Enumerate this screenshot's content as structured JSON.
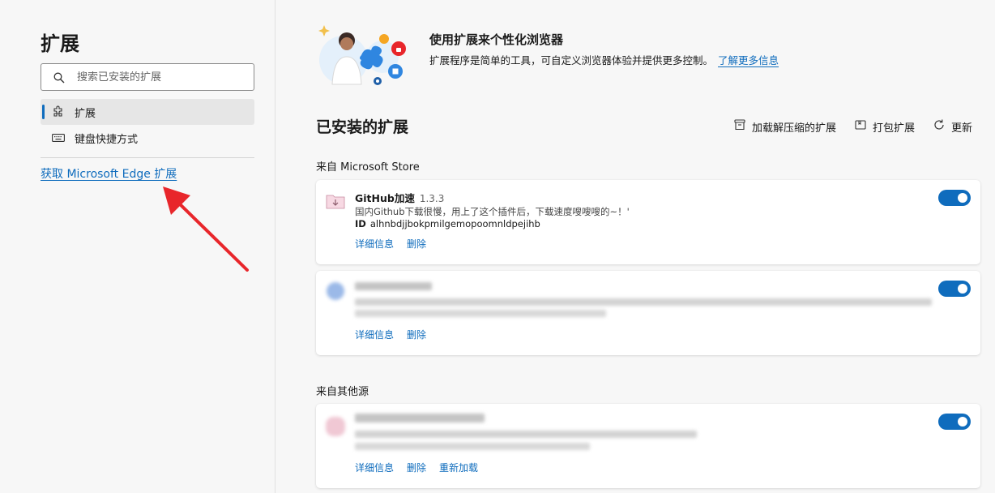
{
  "sidebar": {
    "title": "扩展",
    "search_placeholder": "搜索已安装的扩展",
    "nav": [
      {
        "label": "扩展",
        "active": true
      },
      {
        "label": "键盘快捷方式",
        "active": false
      }
    ],
    "get_link": "获取 Microsoft Edge 扩展"
  },
  "hero": {
    "title": "使用扩展来个性化浏览器",
    "desc": "扩展程序是简单的工具，可自定义浏览器体验并提供更多控制。",
    "learn_more": "了解更多信息"
  },
  "installed": {
    "title": "已安装的扩展",
    "toolbar": {
      "load_unpacked": "加载解压缩的扩展",
      "pack": "打包扩展",
      "update": "更新"
    },
    "store_label": "来自 Microsoft Store",
    "other_label": "来自其他源",
    "extensions": [
      {
        "name": "GitHub加速",
        "version": "1.3.3",
        "desc": "国内Github下载很慢，用上了这个插件后，下载速度嗖嗖嗖的~！'",
        "id_label": "ID",
        "id": "alhnbdjjbokpmilgemopoomnldpejihb",
        "details": "详细信息",
        "remove": "删除",
        "enabled": true
      },
      {
        "details": "详细信息",
        "remove": "删除",
        "enabled": true
      },
      {
        "details": "详细信息",
        "remove": "删除",
        "reload": "重新加载",
        "enabled": true
      }
    ]
  },
  "colors": {
    "accent": "#0f6cbd",
    "arrow": "#e8262b"
  }
}
